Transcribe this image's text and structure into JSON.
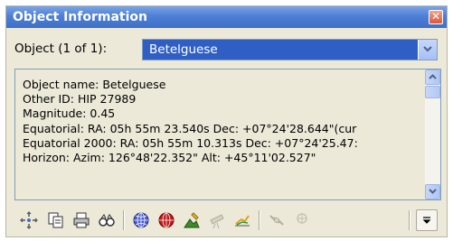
{
  "window": {
    "title": "Object Information"
  },
  "object": {
    "label": "Object (1 of 1):",
    "selected": "Betelguese"
  },
  "info_lines": [
    "Object name: Betelguese",
    "Other ID: HIP 27989",
    "Magnitude: 0.45",
    "Equatorial: RA: 05h 55m 23.540s   Dec: +07°24'28.644\"(cur",
    "Equatorial 2000: RA: 05h 55m 10.313s   Dec: +07°24'25.47:",
    "Horizon: Azim: 126°48'22.352\"   Alt: +45°11'02.527\""
  ],
  "toolbar": {
    "buttons": [
      "center-icon",
      "copy-icon",
      "print-icon",
      "binoculars-icon",
      "globe-blue-icon",
      "globe-red-icon",
      "image-icon",
      "telescope-disabled-icon",
      "chart-icon",
      "satellite-disabled-icon",
      "target-disabled-icon"
    ],
    "more": "chevron-more-icon"
  },
  "colors": {
    "title_bar": "#4d7fd6",
    "selection": "#2f5fc5",
    "window_bg": "#ece9d8"
  }
}
